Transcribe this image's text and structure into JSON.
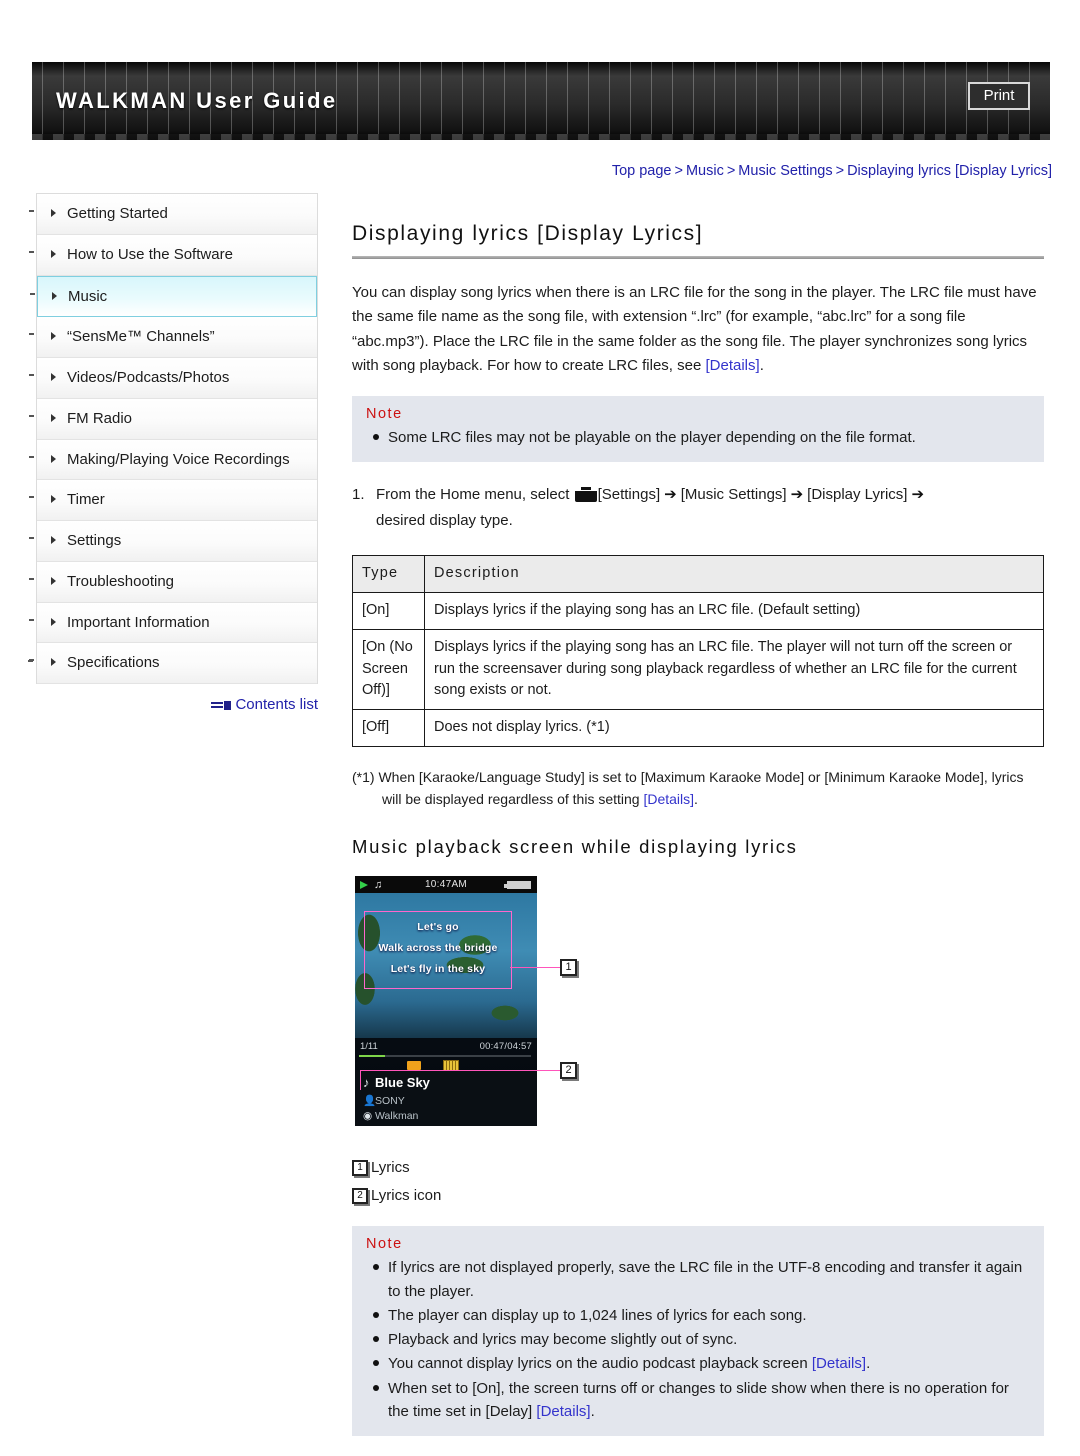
{
  "header": {
    "title": "WALKMAN User Guide",
    "print_label": "Print"
  },
  "breadcrumb": {
    "items": [
      "Top page",
      "Music",
      "Music Settings",
      "Displaying lyrics [Display Lyrics]"
    ],
    "separator": ">"
  },
  "sidebar": {
    "items": [
      {
        "label": "Getting Started",
        "active": false
      },
      {
        "label": "How to Use the Software",
        "active": false
      },
      {
        "label": "Music",
        "active": true
      },
      {
        "label": "“SensMe™ Channels”",
        "active": false
      },
      {
        "label": "Videos/Podcasts/Photos",
        "active": false
      },
      {
        "label": "FM Radio",
        "active": false
      },
      {
        "label": "Making/Playing Voice Recordings",
        "active": false
      },
      {
        "label": "Timer",
        "active": false
      },
      {
        "label": "Settings",
        "active": false
      },
      {
        "label": "Troubleshooting",
        "active": false
      },
      {
        "label": "Important Information",
        "active": false
      },
      {
        "label": "Specifications",
        "active": false
      }
    ],
    "contents_link": "Contents list"
  },
  "main": {
    "title": "Displaying lyrics [Display Lyrics]",
    "intro_part1": "You can display song lyrics when there is an LRC file for the song in the player. The LRC file must have the same file name as the song file, with extension “.lrc” (for example, “abc.lrc” for a song file “abc.mp3”). Place the LRC file in the same folder as the song file. The player synchronizes song lyrics with song playback. For how to create LRC files, see ",
    "intro_link": "[Details]",
    "intro_part2": ".",
    "note_top": {
      "heading": "Note",
      "items": [
        "Some LRC files may not be playable on the player depending on the file format."
      ]
    },
    "step": {
      "number": "1.",
      "text_a": "From the Home menu, select",
      "icon": "toolbox-icon",
      "text_b": "[Settings]",
      "arrow": "➔",
      "text_c": "[Music Settings]",
      "text_d": "[Display Lyrics]",
      "text_e": "desired display type."
    },
    "table": {
      "headers": [
        "Type",
        "Description"
      ],
      "rows": [
        [
          "[On]",
          "Displays lyrics if the playing song has an LRC file. (Default setting)"
        ],
        [
          "[On (No Screen Off)]",
          "Displays lyrics if the playing song has an LRC file. The player will not turn off the screen or run the screensaver during song playback regardless of whether an LRC file for the current song exists or not."
        ],
        [
          "[Off]",
          "Does not display lyrics. (*1)"
        ]
      ]
    },
    "footnote_a": "(*1) When [Karaoke/Language Study] is set to [Maximum Karaoke Mode] or [Minimum Karaoke Mode], lyrics will be displayed regardless of this setting ",
    "footnote_link": "[Details]",
    "footnote_b": ".",
    "sub_heading": "Music playback screen while displaying lyrics",
    "device": {
      "clock": "10:47AM",
      "lyrics": [
        "Let's go",
        "Walk across the bridge",
        "Let's fly in the sky"
      ],
      "track_position": "1/11",
      "time": "00:47/04:57",
      "song_title": "Blue Sky",
      "artist": "SONY",
      "album": "Walkman",
      "callout_1": "1",
      "callout_2": "2"
    },
    "legend": [
      {
        "num": "1",
        "label": "Lyrics"
      },
      {
        "num": "2",
        "label": "Lyrics icon"
      }
    ],
    "note_bottom": {
      "heading": "Note",
      "items": [
        {
          "text_a": "If lyrics are not displayed properly, save the LRC file in the UTF-8 encoding and transfer it again to the player.",
          "link": "",
          "text_b": ""
        },
        {
          "text_a": "The player can display up to 1,024 lines of lyrics for each song.",
          "link": "",
          "text_b": ""
        },
        {
          "text_a": "Playback and lyrics may become slightly out of sync.",
          "link": "",
          "text_b": ""
        },
        {
          "text_a": "You cannot display lyrics on the audio podcast playback screen ",
          "link": "[Details]",
          "text_b": "."
        },
        {
          "text_a": "When set to [On], the screen turns off or changes to slide show when there is no operation for the time set in [Delay] ",
          "link": "[Details]",
          "text_b": "."
        }
      ]
    }
  },
  "colors": {
    "link": "#3333cc",
    "breadcrumb": "#2222aa",
    "note_heading": "#cc1111",
    "note_bg": "#e3e6ed",
    "active_nav": "#d8f6fb"
  }
}
